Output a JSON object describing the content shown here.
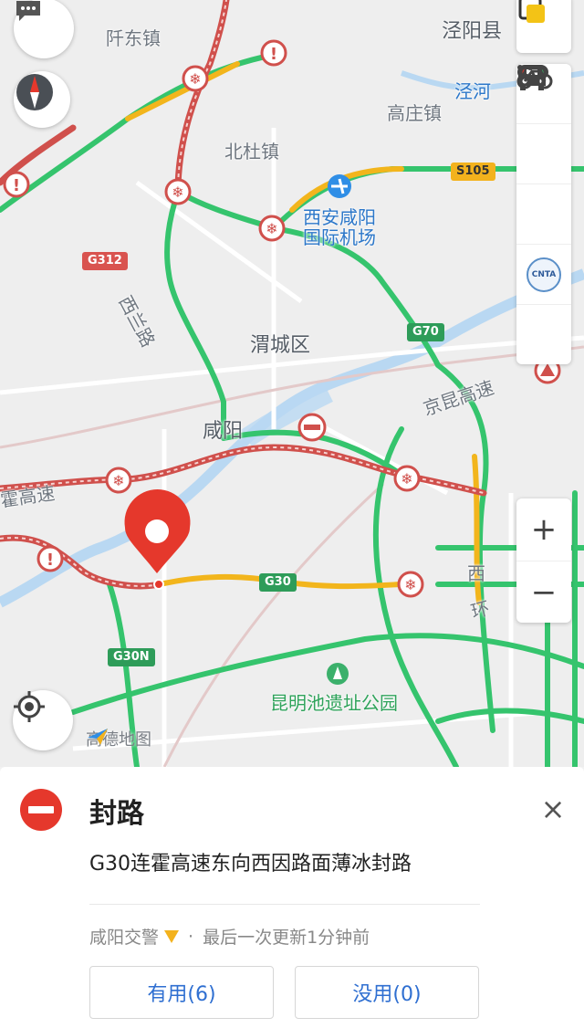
{
  "map": {
    "places": {
      "qiandong": "阡东镇",
      "jingyang": "泾阳县",
      "jinghe": "泾河",
      "gaozhuang": "高庄镇",
      "beidu": "北杜镇",
      "airport_line1": "西安咸阳",
      "airport_line2": "国际机场",
      "weicheng": "渭城区",
      "xianyang": "咸阳",
      "xihuan_road": "西兰路",
      "jingkun": "京昆高速",
      "lianhuo": "霍高速",
      "west_ring_1": "西",
      "west_ring_2": "环",
      "park": "昆明池遗址公园",
      "lu_fragment": "路"
    },
    "shields": {
      "g312": "G312",
      "s105": "S105",
      "g70": "G70",
      "g30": "G30",
      "g30n": "G30N"
    },
    "logo": "高德地图"
  },
  "toolbar": {
    "message_icon": "chat-bubble-icon",
    "compass_icon": "compass-icon",
    "locate_icon": "locate-icon",
    "layers_icon": "layers-icon",
    "traffic_icon": "traffic-light-icon",
    "car_icon": "car-icon",
    "bike_icon": "bicycle-icon",
    "cnta_label": "CNTA",
    "more_icon": "more-icon",
    "zoom_in": "+",
    "zoom_out": "−"
  },
  "incident": {
    "title": "封路",
    "description": "G30连霍高速东向西因路面薄冰封路",
    "source": "咸阳交警",
    "separator": "·",
    "updated": "最后一次更新1分钟前",
    "useful_button": "有用(6)",
    "useless_button": "没用(0)",
    "close": "×"
  },
  "colors": {
    "road_green": "#35c46d",
    "road_yellow": "#f2b51c",
    "road_red": "#d0504c",
    "marker_red": "#e5382c",
    "link_blue": "#2f6fd1"
  }
}
